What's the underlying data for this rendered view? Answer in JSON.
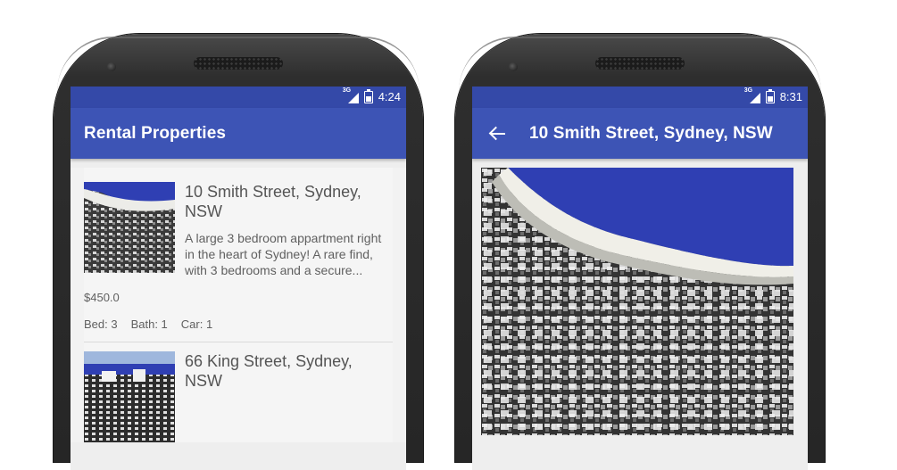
{
  "left_screen": {
    "status": {
      "network": "3G",
      "time": "4:24"
    },
    "app_title": "Rental Properties",
    "listings": [
      {
        "title": "10 Smith Street, Sydney, NSW",
        "description": "A large 3 bedroom appartment right in the heart of Sydney! A rare find, with 3 bedrooms and a secure...",
        "price": "$450.0",
        "bed": "Bed: 3",
        "bath": "Bath: 1",
        "car": "Car: 1"
      },
      {
        "title": "66 King Street, Sydney, NSW"
      }
    ]
  },
  "right_screen": {
    "status": {
      "network": "3G",
      "time": "8:31"
    },
    "title": "10 Smith Street, Sydney, NSW",
    "icons": {
      "back": "arrow-back-icon"
    }
  },
  "colors": {
    "status_bar": "#3449a8",
    "app_bar": "#3d54b5",
    "background": "#eeeeee"
  }
}
